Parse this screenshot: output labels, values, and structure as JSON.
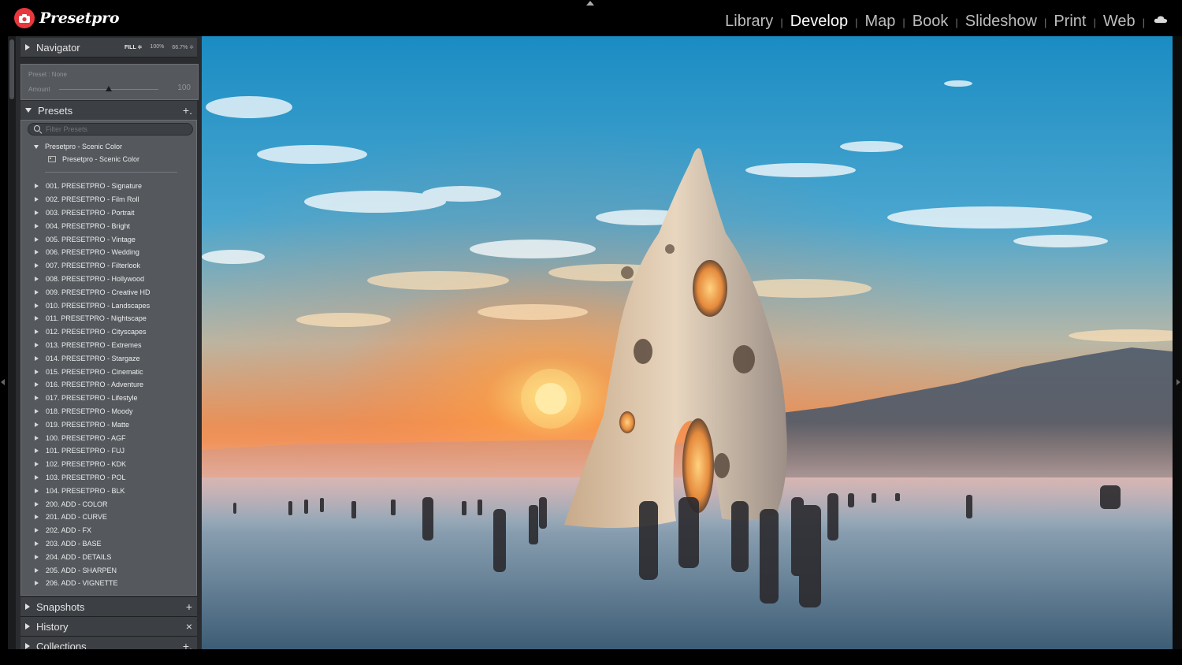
{
  "app": {
    "logo_text": "Presetpro"
  },
  "modules": [
    {
      "label": "Library",
      "active": false
    },
    {
      "label": "Develop",
      "active": true
    },
    {
      "label": "Map",
      "active": false
    },
    {
      "label": "Book",
      "active": false
    },
    {
      "label": "Slideshow",
      "active": false
    },
    {
      "label": "Print",
      "active": false
    },
    {
      "label": "Web",
      "active": false
    }
  ],
  "module_separator": "|",
  "navigator": {
    "title": "Navigator",
    "fill": "FILL ≑",
    "zoom1": "100%",
    "zoom2": "66.7% ≑"
  },
  "preset_amount": {
    "preset_label": "Preset : None",
    "amount_label": "Amount",
    "amount_value": "100",
    "slider_fraction": 0.5
  },
  "presets": {
    "title": "Presets",
    "add": "+.",
    "filter_placeholder": "Filter Presets",
    "open_folder": "Presetpro - Scenic Color",
    "open_folder_item": "Presetpro - Scenic Color",
    "folders": [
      "001. PRESETPRO - Signature",
      "002. PRESETPRO - Film Roll",
      "003. PRESETPRO - Portrait",
      "004. PRESETPRO - Bright",
      "005. PRESETPRO - Vintage",
      "006. PRESETPRO - Wedding",
      "007. PRESETPRO - Filterlook",
      "008. PRESETPRO - Hollywood",
      "009. PRESETPRO - Creative HD",
      "010. PRESETPRO - Landscapes",
      "011. PRESETPRO - Nightscape",
      "012. PRESETPRO - Cityscapes",
      "013. PRESETPRO - Extremes",
      "014. PRESETPRO - Stargaze",
      "015. PRESETPRO - Cinematic",
      "016. PRESETPRO - Adventure",
      "017. PRESETPRO - Lifestyle",
      "018. PRESETPRO - Moody",
      "019. PRESETPRO - Matte",
      "100. PRESETPRO - AGF",
      "101. PRESETPRO - FUJ",
      "102. PRESETPRO - KDK",
      "103. PRESETPRO - POL",
      "104. PRESETPRO - BLK",
      "200. ADD - COLOR",
      "201. ADD - CURVE",
      "202. ADD - FX",
      "203. ADD - BASE",
      "204. ADD - DETAILS",
      "205. ADD - SHARPEN",
      "206. ADD - VIGNETTE"
    ]
  },
  "snapshots": {
    "title": "Snapshots",
    "action": "+"
  },
  "history": {
    "title": "History",
    "action": "×"
  },
  "collections": {
    "title": "Collections",
    "action": "+."
  },
  "colors": {
    "logo_red": "#e8383d",
    "panel_bg": "#55595e",
    "header_bg": "#3c3f43",
    "sky_top": "#1f8fc4",
    "sun": "#fff2b0"
  },
  "icons": [
    "camera-icon",
    "cloud-icon",
    "search-icon",
    "preset-icon",
    "triangle-right-icon",
    "triangle-down-icon"
  ]
}
